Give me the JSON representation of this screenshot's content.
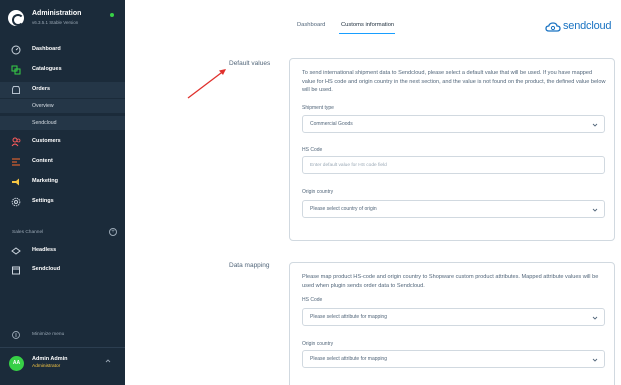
{
  "sidebar": {
    "brand_title": "Administration",
    "brand_version": "v6.3.5.1 Stable Version",
    "items": [
      {
        "label": "Dashboard",
        "icon": "gauge-icon"
      },
      {
        "label": "Catalogues",
        "icon": "catalogue-icon"
      },
      {
        "label": "Orders",
        "icon": "orders-icon"
      },
      {
        "label": "Customers",
        "icon": "customers-icon"
      },
      {
        "label": "Content",
        "icon": "content-icon"
      },
      {
        "label": "Marketing",
        "icon": "megaphone-icon"
      },
      {
        "label": "Settings",
        "icon": "gear-icon"
      }
    ],
    "sub_items": [
      "Overview",
      "Sendcloud"
    ],
    "sales_channel_label": "Sales Channel",
    "sales_channels": [
      {
        "label": "Headless",
        "icon": "headless-icon"
      },
      {
        "label": "Sendcloud",
        "icon": "storefront-icon"
      }
    ],
    "minimize_label": "Minimize menu",
    "user": {
      "initials": "AA",
      "name": "Admin Admin",
      "role": "Administrator"
    }
  },
  "tabs": [
    {
      "label": "Dashboard",
      "active": false
    },
    {
      "label": "Customs information",
      "active": true
    }
  ],
  "brand_logo_text": "sendcloud",
  "default_values": {
    "section_label": "Default values",
    "description": "To send international shipment data to Sendcloud, please select a default value that will be used. If you have mapped value for HS code and origin country in the next section, and the value is not found on the product, the defined value below will be used.",
    "shipment_type_label": "Shipment type",
    "shipment_type_value": "Commercial Goods",
    "hs_code_label": "HS Code",
    "hs_code_placeholder": "Enter default value for HS code field",
    "origin_country_label": "Origin country",
    "origin_country_value": "Please select country of origin"
  },
  "data_mapping": {
    "section_label": "Data mapping",
    "description": "Please map product HS-code and origin country to Shopware custom product attributes. Mapped attribute values will be used when plugin sends order data to Sendcloud.",
    "hs_code_label": "HS Code",
    "hs_code_value": "Please select attribute for mapping",
    "origin_country_label": "Origin country",
    "origin_country_value": "Please select attribute for mapping"
  },
  "colors": {
    "sidebar_bg": "#1b2b3a",
    "accent": "#189eff",
    "annotation_arrow": "#e0302c",
    "brand_green": "#37d046",
    "role_yellow": "#f6c643"
  }
}
